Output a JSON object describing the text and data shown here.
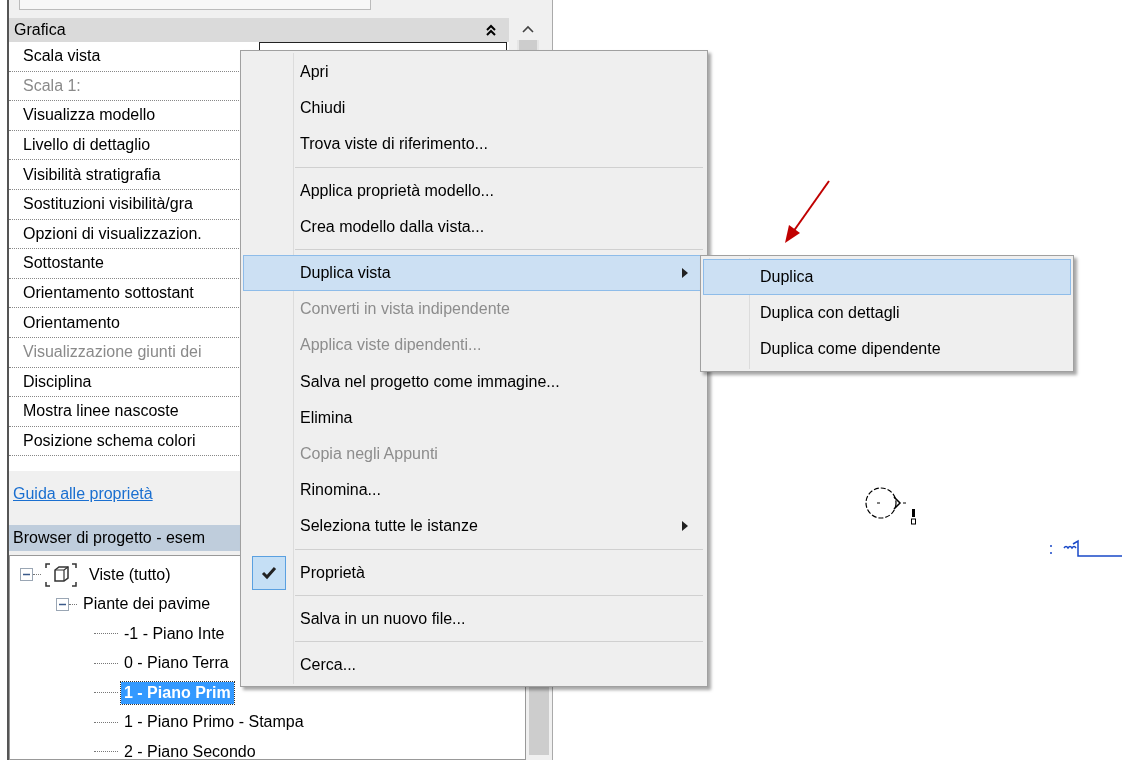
{
  "properties": {
    "section": {
      "title": "Grafica"
    },
    "rows": [
      {
        "label": "Scala vista",
        "disabled": false
      },
      {
        "label": "Scala  1:",
        "disabled": true
      },
      {
        "label": "Visualizza modello",
        "disabled": false
      },
      {
        "label": "Livello di dettaglio",
        "disabled": false
      },
      {
        "label": "Visibilità stratigrafia",
        "disabled": false
      },
      {
        "label": "Sostituzioni visibilità/gra",
        "disabled": false
      },
      {
        "label": "Opzioni di visualizzazion.",
        "disabled": false
      },
      {
        "label": "Sottostante",
        "disabled": false
      },
      {
        "label": "Orientamento sottostant",
        "disabled": false
      },
      {
        "label": "Orientamento",
        "disabled": false
      },
      {
        "label": "Visualizzazione giunti dei",
        "disabled": true
      },
      {
        "label": "Disciplina",
        "disabled": false
      },
      {
        "label": "Mostra linee nascoste",
        "disabled": false
      },
      {
        "label": "Posizione schema colori",
        "disabled": false
      }
    ],
    "help_link": "Guida alle proprietà"
  },
  "project_browser": {
    "title": "Browser di progetto - esem",
    "tree": [
      {
        "label": "Viste (tutto)",
        "expanded": true,
        "selected": false,
        "children": [
          {
            "label": "Piante dei pavime",
            "expanded": true,
            "selected": false,
            "children": [
              {
                "label": "-1 - Piano Inte",
                "selected": false
              },
              {
                "label": "0 - Piano Terra",
                "selected": false
              },
              {
                "label": "1 - Piano Prim",
                "selected": true
              },
              {
                "label": "1 - Piano Primo - Stampa",
                "selected": false
              },
              {
                "label": "2 - Piano Secondo",
                "selected": false
              }
            ]
          }
        ]
      }
    ]
  },
  "context_menu": {
    "items": [
      {
        "kind": "item",
        "label": "Apri",
        "disabled": false,
        "selected": false,
        "checked": false,
        "submenu": false
      },
      {
        "kind": "item",
        "label": "Chiudi",
        "disabled": false,
        "selected": false,
        "checked": false,
        "submenu": false
      },
      {
        "kind": "item",
        "label": "Trova viste di riferimento...",
        "disabled": false,
        "selected": false,
        "checked": false,
        "submenu": false
      },
      {
        "kind": "separator"
      },
      {
        "kind": "item",
        "label": "Applica proprietà modello...",
        "disabled": false,
        "selected": false,
        "checked": false,
        "submenu": false
      },
      {
        "kind": "item",
        "label": "Crea modello dalla vista...",
        "disabled": false,
        "selected": false,
        "checked": false,
        "submenu": false
      },
      {
        "kind": "separator"
      },
      {
        "kind": "item",
        "label": "Duplica vista",
        "disabled": false,
        "selected": true,
        "checked": false,
        "submenu": true
      },
      {
        "kind": "item",
        "label": "Converti in vista indipendente",
        "disabled": true,
        "selected": false,
        "checked": false,
        "submenu": false
      },
      {
        "kind": "item",
        "label": "Applica viste dipendenti...",
        "disabled": true,
        "selected": false,
        "checked": false,
        "submenu": false
      },
      {
        "kind": "item",
        "label": "Salva nel progetto come immagine...",
        "disabled": false,
        "selected": false,
        "checked": false,
        "submenu": false
      },
      {
        "kind": "item",
        "label": "Elimina",
        "disabled": false,
        "selected": false,
        "checked": false,
        "submenu": false
      },
      {
        "kind": "item",
        "label": "Copia negli Appunti",
        "disabled": true,
        "selected": false,
        "checked": false,
        "submenu": false
      },
      {
        "kind": "item",
        "label": "Rinomina...",
        "disabled": false,
        "selected": false,
        "checked": false,
        "submenu": false
      },
      {
        "kind": "item",
        "label": "Seleziona tutte le istanze",
        "disabled": false,
        "selected": false,
        "checked": false,
        "submenu": true
      },
      {
        "kind": "separator"
      },
      {
        "kind": "item",
        "label": "Proprietà",
        "disabled": false,
        "selected": false,
        "checked": true,
        "submenu": false
      },
      {
        "kind": "separator"
      },
      {
        "kind": "item",
        "label": "Salva in un nuovo file...",
        "disabled": false,
        "selected": false,
        "checked": false,
        "submenu": false
      },
      {
        "kind": "separator"
      },
      {
        "kind": "item",
        "label": "Cerca...",
        "disabled": false,
        "selected": false,
        "checked": false,
        "submenu": false
      }
    ]
  },
  "submenu": {
    "items": [
      {
        "label": "Duplica",
        "selected": true
      },
      {
        "label": "Duplica con dettagli",
        "selected": false
      },
      {
        "label": "Duplica come dipendente",
        "selected": false
      }
    ]
  }
}
